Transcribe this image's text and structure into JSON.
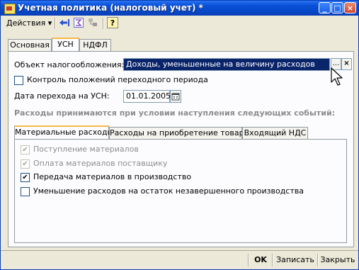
{
  "window": {
    "title": "Учетная политика (налоговый учет) *",
    "btn_minimize": "_",
    "btn_maximize": "□",
    "btn_close": "×"
  },
  "toolbar": {
    "actions_label": "Действия",
    "actions_arrow": "▾",
    "help_label": "?"
  },
  "tabs": [
    {
      "label": "Основная"
    },
    {
      "label": "УСН"
    },
    {
      "label": "НДФЛ"
    }
  ],
  "form": {
    "tax_object_label": "Объект налогообложения:",
    "tax_object_value": "Доходы, уменьшенные на величину расходов",
    "select_btn": "...",
    "clear_btn": "×",
    "transition_control_label": "Контроль положений переходного периода",
    "transition_date_label": "Дата перехода на УСН:",
    "transition_date_value": "01.01.2005"
  },
  "section_heading": "Расходы принимаются при условии наступления следующих событий:",
  "inner_tabs": [
    {
      "label": "Материальные расходы"
    },
    {
      "label": "Расходы на приобретение товаров"
    },
    {
      "label": "Входящий НДС"
    }
  ],
  "checks": [
    {
      "label": "Поступление материалов",
      "checked": true,
      "disabled": true
    },
    {
      "label": "Оплата материалов поставщику",
      "checked": true,
      "disabled": true
    },
    {
      "label": "Передача материалов в производство",
      "checked": true,
      "disabled": false
    },
    {
      "label": "Уменьшение расходов на остаток незавершенного производства",
      "checked": false,
      "disabled": false
    }
  ],
  "footer": {
    "ok": "OK",
    "save": "Записать",
    "close": "Закрыть"
  }
}
